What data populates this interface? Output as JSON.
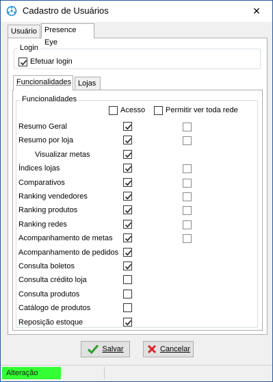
{
  "window": {
    "title": "Cadastro de Usuários",
    "close_glyph": "✕"
  },
  "tabs": [
    {
      "label": "Usuário",
      "active": false
    },
    {
      "label": "Presence Eye",
      "active": true
    }
  ],
  "login": {
    "group_title": "Login",
    "checkbox_label": "Efetuar login",
    "checked": true
  },
  "inner_tabs": [
    {
      "label": "Funcionalidades",
      "active": true
    },
    {
      "label": "Lojas",
      "active": false
    }
  ],
  "func": {
    "group_title": "Funcionalidades",
    "col_acesso": "Acesso",
    "col_rede": "Permitir ver toda rede",
    "rows": [
      {
        "label": "Resumo Geral",
        "acesso": true,
        "rede": "unchecked"
      },
      {
        "label": "Resumo por loja",
        "acesso": true,
        "rede": "unchecked"
      },
      {
        "label": "Visualizar metas",
        "acesso": true,
        "rede": "none",
        "indent": true
      },
      {
        "label": "Índices lojas",
        "acesso": true,
        "rede": "unchecked"
      },
      {
        "label": "Comparativos",
        "acesso": true,
        "rede": "unchecked"
      },
      {
        "label": "Ranking vendedores",
        "acesso": true,
        "rede": "unchecked"
      },
      {
        "label": "Ranking produtos",
        "acesso": true,
        "rede": "unchecked"
      },
      {
        "label": "Ranking redes",
        "acesso": true,
        "rede": "unchecked"
      },
      {
        "label": "Acompanhamento de metas",
        "acesso": true,
        "rede": "unchecked"
      },
      {
        "label": "Acompanhamento de pedidos",
        "acesso": true,
        "rede": "none"
      },
      {
        "label": "Consulta boletos",
        "acesso": true,
        "rede": "none"
      },
      {
        "label": "Consulta crédito loja",
        "acesso": false,
        "rede": "none"
      },
      {
        "label": "Consulta produtos",
        "acesso": false,
        "rede": "none"
      },
      {
        "label": "Catálogo de produtos",
        "acesso": false,
        "rede": "none"
      },
      {
        "label": "Reposição estoque",
        "acesso": true,
        "rede": "none"
      }
    ]
  },
  "buttons": {
    "save": {
      "label": "Salvar",
      "icon": "green-check-icon",
      "color": "#2e9e2e"
    },
    "cancel": {
      "label": "Cancelar",
      "icon": "red-x-icon",
      "color": "#d9262b"
    }
  },
  "status": {
    "text": "Alteração",
    "color": "#33ff33"
  }
}
